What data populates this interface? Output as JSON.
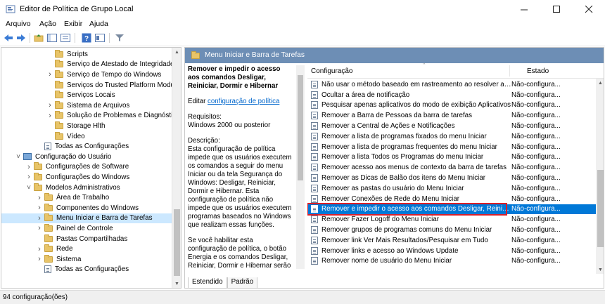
{
  "window": {
    "title": "Editor de Política de Grupo Local"
  },
  "menu": [
    "Arquivo",
    "Ação",
    "Exibir",
    "Ajuda"
  ],
  "toolbar_icons": [
    "back-icon",
    "forward-icon",
    "up-folder-icon",
    "show-hide-tree-icon",
    "export-list-icon",
    "help-icon",
    "properties-icon",
    "filter-icon"
  ],
  "tree": [
    {
      "label": "Scripts",
      "indent": 4,
      "icon": "folder",
      "exp": ""
    },
    {
      "label": "Serviço de Atestado de Integridade de",
      "indent": 4,
      "icon": "folder",
      "exp": ""
    },
    {
      "label": "Serviço de Tempo do Windows",
      "indent": 4,
      "icon": "folder",
      "exp": ">"
    },
    {
      "label": "Serviços do Trusted Platform Module",
      "indent": 4,
      "icon": "folder",
      "exp": ""
    },
    {
      "label": "Serviços Locais",
      "indent": 4,
      "icon": "folder",
      "exp": ""
    },
    {
      "label": "Sistema de Arquivos",
      "indent": 4,
      "icon": "folder",
      "exp": ">"
    },
    {
      "label": "Solução de Problemas e Diagnóstico",
      "indent": 4,
      "icon": "folder",
      "exp": ">"
    },
    {
      "label": "Storage Hlth",
      "indent": 4,
      "icon": "folder",
      "exp": ""
    },
    {
      "label": "Vídeo",
      "indent": 4,
      "icon": "folder",
      "exp": ""
    },
    {
      "label": "Todas as Configurações",
      "indent": 3,
      "icon": "policy",
      "exp": ""
    },
    {
      "label": "Configuração do Usuário",
      "indent": 1,
      "icon": "pc",
      "exp": "v"
    },
    {
      "label": "Configurações de Software",
      "indent": 2,
      "icon": "folder",
      "exp": ">"
    },
    {
      "label": "Configurações do Windows",
      "indent": 2,
      "icon": "folder",
      "exp": ">"
    },
    {
      "label": "Modelos Administrativos",
      "indent": 2,
      "icon": "folder",
      "exp": "v"
    },
    {
      "label": "Área de Trabalho",
      "indent": 3,
      "icon": "folder",
      "exp": ">"
    },
    {
      "label": "Componentes do Windows",
      "indent": 3,
      "icon": "folder",
      "exp": ">"
    },
    {
      "label": "Menu Iniciar e Barra de Tarefas",
      "indent": 3,
      "icon": "folder",
      "exp": ">",
      "selected": true
    },
    {
      "label": "Painel de Controle",
      "indent": 3,
      "icon": "folder",
      "exp": ">"
    },
    {
      "label": "Pastas Compartilhadas",
      "indent": 3,
      "icon": "folder",
      "exp": ""
    },
    {
      "label": "Rede",
      "indent": 3,
      "icon": "folder",
      "exp": ">"
    },
    {
      "label": "Sistema",
      "indent": 3,
      "icon": "folder",
      "exp": ">"
    },
    {
      "label": "Todas as Configurações",
      "indent": 3,
      "icon": "policy",
      "exp": ""
    }
  ],
  "right_header": "Menu Iniciar e Barra de Tarefas",
  "description": {
    "heading": "Remover e impedir o acesso aos comandos Desligar, Reiniciar, Dormir e Hibernar",
    "edit_prefix": "Editar",
    "edit_link": "configuração de política",
    "requirements_label": "Requisitos:",
    "requirements_value": "Windows 2000 ou posterior",
    "description_label": "Descrição:",
    "description_text": "Esta configuração de política impede que os usuários executem os comandos a seguir do menu Iniciar ou da tela Segurança do Windows: Desligar, Reiniciar, Dormir e Hibernar. Esta configuração de política não impede que os usuários executem programas baseados no Windows que realizam essas funções.",
    "extra_text": "Se você habilitar esta configuração de política, o botão Energia e os comandos Desligar, Reiniciar, Dormir e Hibernar serão"
  },
  "list_headers": {
    "setting": "Configuração",
    "state": "Estado"
  },
  "policies": [
    {
      "name": "Não usar o método baseado em rastreamento ao resolver at...",
      "state": "Não-configura..."
    },
    {
      "name": "Ocultar a área de notificação",
      "state": "Não-configura..."
    },
    {
      "name": "Pesquisar apenas aplicativos do modo de exibição Aplicativos",
      "state": "Não-configura..."
    },
    {
      "name": "Remover a Barra de Pessoas da barra de tarefas",
      "state": "Não-configura..."
    },
    {
      "name": "Remover a Central de Ações e Notificações",
      "state": "Não-configura..."
    },
    {
      "name": "Remover a lista de programas fixados do menu Iniciar",
      "state": "Não-configura..."
    },
    {
      "name": "Remover a lista de programas frequentes do menu Iniciar",
      "state": "Não-configura..."
    },
    {
      "name": "Remover a lista Todos os Programas do menu Iniciar",
      "state": "Não-configura..."
    },
    {
      "name": "Remover acesso aos menus de contexto da barra de tarefas",
      "state": "Não-configura..."
    },
    {
      "name": "Remover as Dicas de Balão dos itens do Menu Iniciar",
      "state": "Não-configura..."
    },
    {
      "name": "Remover as pastas do usuário do Menu Iniciar",
      "state": "Não-configura..."
    },
    {
      "name": "Remover Conexões de Rede do Menu Iniciar",
      "state": "Não-configura..."
    },
    {
      "name": "Remover e impedir o acesso aos comandos Desligar, Reinici...",
      "state": "Não-configura...",
      "selected": true
    },
    {
      "name": "Remover Fazer Logoff do Menu Iniciar",
      "state": "Não-configura..."
    },
    {
      "name": "Remover grupos de programas comuns do Menu Iniciar",
      "state": "Não-configura..."
    },
    {
      "name": "Remover link Ver Mais Resultados/Pesquisar em Tudo",
      "state": "Não-configura..."
    },
    {
      "name": "Remover links e acesso ao Windows Update",
      "state": "Não-configura..."
    },
    {
      "name": "Remover nome de usuário do Menu Iniciar",
      "state": "Não-configura..."
    }
  ],
  "tabs": [
    "Estendido",
    "Padrão"
  ],
  "status": "94 configuração(ões)"
}
